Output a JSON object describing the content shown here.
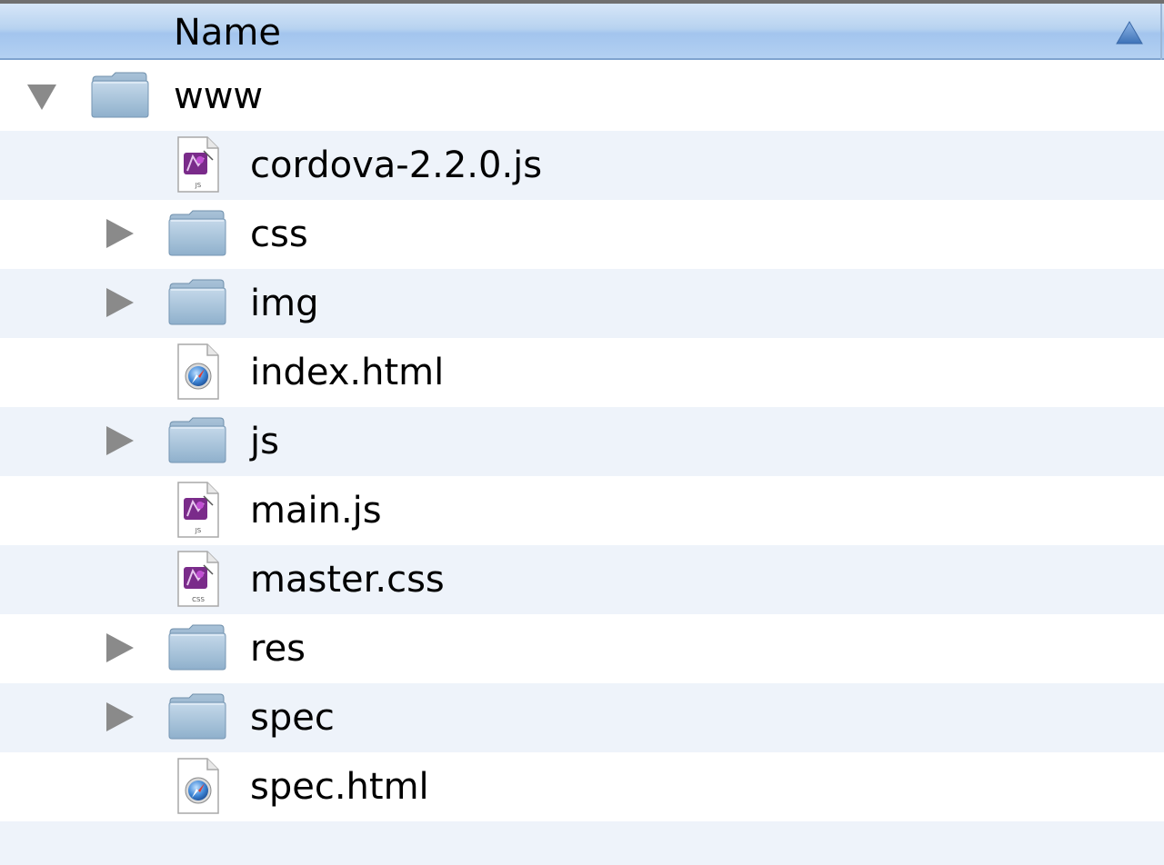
{
  "header": {
    "column_name": "Name",
    "sort_direction": "ascending"
  },
  "colors": {
    "header_top": "#d6e6f8",
    "header_bottom": "#a3c5ee",
    "alt_row": "#eef3fa",
    "folder_blue": "#9dbad4"
  },
  "tree": {
    "root": {
      "label": "www",
      "icon": "folder-icon",
      "expanded": true
    },
    "items": [
      {
        "label": "cordova-2.2.0.js",
        "icon": "js-file-icon",
        "kind": "file",
        "badge": "JS"
      },
      {
        "label": "css",
        "icon": "folder-icon",
        "kind": "folder",
        "expanded": false
      },
      {
        "label": "img",
        "icon": "folder-icon",
        "kind": "folder",
        "expanded": false
      },
      {
        "label": "index.html",
        "icon": "html-file-icon",
        "kind": "file"
      },
      {
        "label": "js",
        "icon": "folder-icon",
        "kind": "folder",
        "expanded": false
      },
      {
        "label": "main.js",
        "icon": "js-file-icon",
        "kind": "file",
        "badge": "JS"
      },
      {
        "label": "master.css",
        "icon": "css-file-icon",
        "kind": "file",
        "badge": "CSS"
      },
      {
        "label": "res",
        "icon": "folder-icon",
        "kind": "folder",
        "expanded": false
      },
      {
        "label": "spec",
        "icon": "folder-icon",
        "kind": "folder",
        "expanded": false
      },
      {
        "label": "spec.html",
        "icon": "html-file-icon",
        "kind": "file"
      }
    ]
  }
}
